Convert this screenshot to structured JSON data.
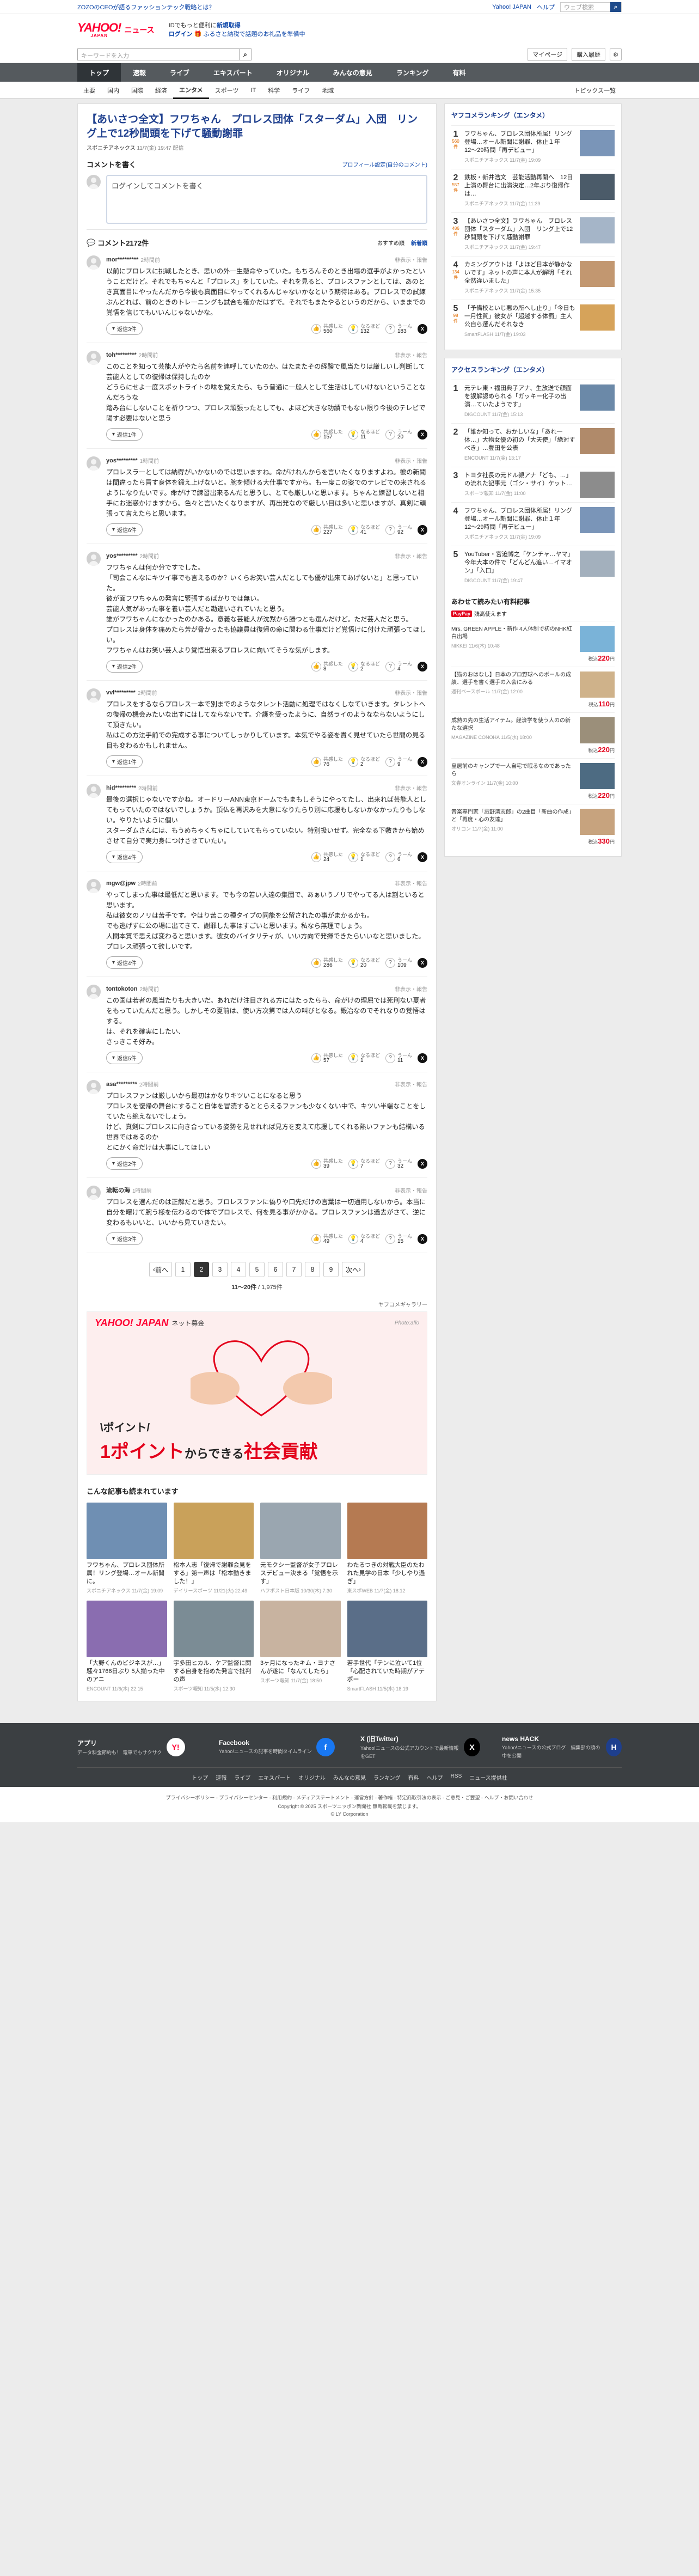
{
  "top": {
    "promo": "ZOZOのCEOが語るファッションテック戦略とは？",
    "links": [
      "Yahoo! JAPAN",
      "ヘルプ"
    ],
    "mini_search_placeholder": "ウェブ検索",
    "logo": "YAHOO!",
    "logo_sub": "JAPAN",
    "logo_news": "ニュース",
    "msg1_prefix": "IDでもっと便利に",
    "msg1_link": "新規取得",
    "msg2_link": "ログイン",
    "msg2_text": "ふるさと納税で話題のお礼品を準備中",
    "search_placeholder": "キーワードを入力",
    "mypage": "マイページ",
    "buy": "購入履歴"
  },
  "nav": {
    "main": [
      "トップ",
      "速報",
      "ライブ",
      "エキスパート",
      "オリジナル",
      "みんなの意見",
      "ランキング",
      "有料"
    ],
    "sub": [
      "主要",
      "国内",
      "国際",
      "経済",
      "エンタメ",
      "スポーツ",
      "IT",
      "科学",
      "ライフ",
      "地域"
    ],
    "topics": "トピックス一覧"
  },
  "article": {
    "title": "【あいさつ全文】フワちゃん　プロレス団体「スターダム」入団　リング上で12秒間頭を下げて騒動謝罪",
    "source": "スポニチアネックス",
    "date": "11/7(金) 19:47 配信"
  },
  "compose": {
    "heading": "コメントを書く",
    "profile_link": "プロフィール設定(自分のコメント)",
    "placeholder": "ログインしてコメントを書く"
  },
  "comments_head": {
    "title": "コメント2172件",
    "sort_recommended": "おすすめ順",
    "sort_new": "新着順"
  },
  "labels": {
    "report": "非表示・報告",
    "like": "共感した",
    "think": "なるほど",
    "hmm": "うーん"
  },
  "comments": [
    {
      "user": "mor*********",
      "time": "2時間前",
      "text": "以前にプロレスに挑戦したとき、思いの外一生懸命やっていた。もちろんそのとき出場の選手がよかったということだけど。それでもちゃんと「プロレス」をしていた。それを見ると、プロレスファンとしては、あのとき真面目にやったんだから今後も真面目にやってくれるんじゃないかなという期待はある。プロレスでの試練ぶんどれば、前のときのトレーニングも試合も確かだはずで。それでもまたやるというのだから、いままでの覚悟を信じてもいいんじゃないかな。",
      "replies": "返信3件",
      "like": "560",
      "think": "132",
      "hmm": "183"
    },
    {
      "user": "toh*********",
      "time": "2時間前",
      "text": "このことを知って芸能人がやたら名前を連呼していたのか。はたまたその経験で風当たりは厳しいし判断して芸能人としての復帰は保持したのか\nどうらにせよ一度スポットライトの味を覚えたら、もう普通に一般人として生活はしていけないということなんだろうな\n踏み台にしないことを祈りつつ、プロレス頑張ったとしても、よほど大きな功績でもない限り今後のテレビで陽す必要はないと思う",
      "replies": "返信1件",
      "like": "157",
      "think": "11",
      "hmm": "20"
    },
    {
      "user": "yos*********",
      "time": "1時間前",
      "text": "プロレスラーとしては納得がいかないのでは思いますね。命がけれんからを言いたくなりますよね。彼の新聞は間違ったら冒す身体を鍛え上げないと。腕を傾ける大仕事ですから。も一度この姿でのテレビでの来されるようになりたいです。命がけで練習出来るんだと思うし、とても厳しいと思います。ちゃんと練習しないと相手にお迷惑かけますから。色々と言いたくなりますが、再出発なので厳しい目は多いと思いますが、真剣に頑張って言えたらと思います。",
      "replies": "返信6件",
      "like": "227",
      "think": "41",
      "hmm": "92"
    },
    {
      "user": "yos*********",
      "time": "2時間前",
      "text": "フワちゃんは何か分ですでした。\n「司会こんなにキツイ事でも言えるのか？いくらお笑い芸人だとしても優が出来てあげないと」と思っていた。\n彼が面フワちゃんの発言に緊張するばかりでは無い。\n芸能人気があった事を養い芸人だと勘違いされていたと思う。\n誰がフワちゃんになかったのかある。意義な芸能人が沈黙から勝つとも選んだけど。ただ芸人だと思う。\nプロレスは身体を痛めたら芳が脅かったも協議員は復帰の命に関わる仕事だけど覚悟けに付けた頑張ってほしい。\nフワちゃんはお笑い芸人より覚悟出来るプロレスに向いてそうな気がします。",
      "replies": "返信2件",
      "like": "8",
      "think": "2",
      "hmm": "4"
    },
    {
      "user": "vvl*********",
      "time": "2時間前",
      "text": "プロレスをするならプロレス一本で別までのようなタレント活動に処理ではなくしなていきます。タレントへの復帰の機会みたいな出すにはしてならないです。介護を受ったように、自然ライのようなならないようにして頂きたい。\n私はこの方法手前での完成する事についてしっかりしています。本気でやる姿を貴く見せていたら世間の見る目も変わるかもしれません。",
      "replies": "返信1件",
      "like": "76",
      "think": "2",
      "hmm": "9"
    },
    {
      "user": "hid*********",
      "time": "2時間前",
      "text": "最後の選択じゃないですかね。オードリーANN東京ドームでもまもしそうにやってたし、出来れば芸能人としてもっていたのではないでしょうか。頂仏を再沢みを大意になりたらり別に応援もしないかなかったりもしない。やりたいように個い\nスターダムさんには、もうめちゃくちゃにしていてもらっていない。特別扱いせず。完全なる下敷きから始めさせて自分で実力身につけさせていたい。",
      "replies": "返信4件",
      "like": "24",
      "think": "1",
      "hmm": "6"
    },
    {
      "user": "mgw@jpw",
      "time": "2時間前",
      "text": "やってしまった事は最低だと思います。でも今の若い人達の集団で、あぁいうノリでやってる人は割といると思います。\n私は彼女のノリは苦手です。やはり苦この種タイプの同能を公留されたの事がまかるかも。\nでも逃げずに公の場に出てきて、謝罪した事はすごいと思います。私なら無理でしょう。\n人間本質で思えば変わると思います。彼女のバイタリティが、いい方向で発揮できたらいいなと思いました。\nプロレス頑張って欲しいです。",
      "replies": "返信4件",
      "like": "286",
      "think": "20",
      "hmm": "109"
    },
    {
      "user": "tontokoton",
      "time": "2時間前",
      "text": "この国は若者の風当たりも大きいだ。あれだけ注目される方にはたったらら、命がけの理屈では死刑ない夏者をもっていたんだと思う。しかしその夏前は、使い方次第では人の叫びとなる。鍛冶なのでそれなりの覚悟はする。\nは、それを確実にしたい、\nさっきこそ好み。",
      "replies": "返信5件",
      "like": "57",
      "think": "1",
      "hmm": "11"
    },
    {
      "user": "asa*********",
      "time": "2時間前",
      "text": "プロレスファンは厳しいから最初はかなりキツいことになると思う\nプロレスを復帰の舞台にすること自体を冒涜するととらえるファンも少なくない中で、キツい半端なことをしていたら絶えないでしょう。\nけど、真剣にプロレスに向き合っている姿勢を見せれれば見方を変えて応援してくれる熱いファンも結構いる世界ではあるのか\nとにかく命だけは大事にしてほしい",
      "replies": "返信2件",
      "like": "39",
      "think": "7",
      "hmm": "32"
    },
    {
      "user": "流転の海",
      "time": "1時間前",
      "text": "プロレスを選んだのは正解だと思う。プロレスファンに偽りや口先だけの言葉は一切通用しないから。本当に自分を曝けて腕う様を伝わるので体でプロレスで、何を見る事がかかる。プロレスファンは過去がさて、逆に変わるもいいと、いいから見ていきたい。",
      "replies": "返信3件",
      "like": "49",
      "think": "4",
      "hmm": "15"
    }
  ],
  "pager": {
    "prev": "前へ",
    "pages": [
      "1",
      "2",
      "3",
      "4",
      "5",
      "6",
      "7",
      "8",
      "9"
    ],
    "current": "2",
    "next": "次へ",
    "count_bold": "11〜20件",
    "count_rest": "/ 1,975件"
  },
  "gallery_link": "ヤフコメギャラリー",
  "ad": {
    "brand": "YAHOO! JAPAN",
    "sub": "ネット募金",
    "photo": "Photo:aflo",
    "line1": "\\ポイント/",
    "line2_prefix": "1ポイント",
    "line2_mid": "からできる",
    "line2_suffix": "社会貢献"
  },
  "reco": {
    "heading": "こんな記事も読まれています",
    "items": [
      {
        "title": "フワちゃん、プロレス団体所属！リング登場…オール新聞に。",
        "meta": "スポニチアネックス 11/7(金) 19:09",
        "color": "#6f8fb3"
      },
      {
        "title": "松本人志「復帰で謝罪会見をする」第一声は「松本動きました！」",
        "meta": "デイリースポーツ 11/21(火) 22:49",
        "color": "#c9a15a"
      },
      {
        "title": "元モクシー監督が女子プロレスデビュー決まる「覚悟を示す」",
        "meta": "ハフポスト日本版 10/30(木) 7:30",
        "color": "#9aa6b0"
      },
      {
        "title": "わたるつきの対戦大臣のたわれた見学の日本「少しやり過ぎ」",
        "meta": "東スポWEB 11/7(金) 18:12",
        "color": "#b57a52"
      },
      {
        "title": "「大野くんのビジネスが…」騒々1766日ぶり 5人揃った中のアニ",
        "meta": "ENCOUNT 11/6(木) 22:15",
        "color": "#8a6db0"
      },
      {
        "title": "宇多田ヒカル、ケア監督に関する自身を抱めた発言で批判の声",
        "meta": "スポーツ報知 11/5(水) 12:30",
        "color": "#7b8c95"
      },
      {
        "title": "3ヶ月になったキム・ヨナさんが遂に「なんてしたら」",
        "meta": "スポーツ報知 11/7(金) 18:50",
        "color": "#c8b3a0"
      },
      {
        "title": "若手世代「テンに泣いて1位「心配されていた時期がアテボー",
        "meta": "SmartFLASH 11/5(水) 18:19",
        "color": "#5a6e88"
      }
    ]
  },
  "ranking": {
    "heading": "ヤフコメランキング（エンタメ）",
    "items": [
      {
        "no": "1",
        "count": "560件",
        "title": "フワちゃん、プロレス団体所属！リング登場…オール新聞に謝罪、休止１年　12〜29時間「再デビュー」",
        "meta": "スポニチアネックス 11/7(金) 19:09",
        "color": "#7a95b8"
      },
      {
        "no": "2",
        "count": "557件",
        "title": "鉄板・新井浩文　芸能活動再開へ　12日上演の舞台に出演決定…2年ぶり復帰作は…",
        "meta": "スポニチアネックス 11/7(金) 11:39",
        "color": "#4b5b69"
      },
      {
        "no": "3",
        "count": "486件",
        "title": "【あいさつ全文】フワちゃん　プロレス団体「スターダム」入団　リング上で12秒間頭を下げて騒動謝罪",
        "meta": "スポニチアネックス 11/7(金) 19:47",
        "color": "#a5b5c8"
      },
      {
        "no": "4",
        "count": "134件",
        "title": "カミングアウトは「よほど日本が静かないです」ネットの声に本人が解明「それ全然違いました」",
        "meta": "スポニチアネックス 11/7(金) 15:35",
        "color": "#c29770"
      },
      {
        "no": "5",
        "count": "98件",
        "title": "「予備校といじ悪の所へし止り」「今日も一月性質」彼女が「超越する体罰」主人公自ら選んだそれなき",
        "meta": "SmartFLASH 11/7(金) 19:03",
        "color": "#d6a35a"
      }
    ]
  },
  "access": {
    "heading": "アクセスランキング（エンタメ）",
    "items": [
      {
        "no": "1",
        "title": "元テレ東・福田典子アナ、生放送で顔面を誤解認められる「ガッキー化子の出演…ていたようです」",
        "meta": "DIGCOUNT 11/7(金) 15:13",
        "color": "#6b89a8"
      },
      {
        "no": "2",
        "title": "「誰か知って、おかしいな」「あれ一体…」大物女優の初の「大天使」「絶対すべき」…豊田を公表",
        "meta": "ENCOUNT 11/7(金) 13:17",
        "color": "#b08a6a"
      },
      {
        "no": "3",
        "title": "トヨタ社長の元ドル親アナ「ども、…」の流れた記事元（ゴシ・サイ）ケット…",
        "meta": "スポーツ報知 11/7(金) 11:00",
        "color": "#8c8c8c"
      },
      {
        "no": "4",
        "title": "フワちゃん、プロレス団体所属！リング登場…オール新聞に謝罪、休止１年　12〜29時間「再デビュー」",
        "meta": "スポニチアネックス 11/7(金) 19:09",
        "color": "#7a95b8"
      },
      {
        "no": "5",
        "title": "YouTuber・宮迫博之「ケンチャ…ヤマ」　今年大本の件で「どんどん追い…イマオン」「入口」",
        "meta": "DIGCOUNT 11/7(金) 19:47",
        "color": "#a3b0bd"
      }
    ]
  },
  "shopping": {
    "heading": "あわせて読みたい有料記事",
    "paypay_badge": "PayPay",
    "paypay_text": "残高使えます",
    "items": [
      {
        "title": "Mrs. GREEN APPLE・新作 4人体制で初のNHK紅白出場",
        "meta": "NIKKEI 11/6(木) 10:48",
        "price": "220",
        "color": "#7ab3d8"
      },
      {
        "title": "【猫のおはなし】日本のプロ野球へのボールの成績、選手を書く選手の入会にみる",
        "meta": "週刊ベースボール 11/7(金) 12:00",
        "price": "110",
        "color": "#cfb28a"
      },
      {
        "title": "成熟の先の生活アイテム。経済学を使う人のの新たな選択",
        "meta": "MAGAZINE CONOHA 11/5(水) 18:00",
        "price": "220",
        "color": "#9b8f7a"
      },
      {
        "title": "皇居前のキャンプで一人自宅で眠るなのであったら",
        "meta": "文春オンライン 11/7(金) 10:00",
        "price": "220",
        "color": "#4d6b82"
      },
      {
        "title": "音楽専門家「忌野清志郎」の2曲目「新曲の作成」と「再度・心の友達」",
        "meta": "オリコン 11/7(金) 11:00",
        "price": "330",
        "color": "#c7a37e"
      }
    ]
  },
  "footer": {
    "cols": [
      {
        "name": "アプリ",
        "desc": "データ料金節約も！ 電車でもサクサク",
        "icon": "Y!"
      },
      {
        "name": "Facebook",
        "desc": "Yahoo!ニュースの記事を時間タイムライン",
        "icon": "f"
      },
      {
        "name": "X (旧Twitter)",
        "desc": "Yahoo!ニュースの公式アカウントで最新情報をGET",
        "icon": "X"
      },
      {
        "name": "news HACK",
        "desc": "Yahoo!ニュースの公式ブログ　編集部の頭の中を公開",
        "icon": "H"
      }
    ],
    "nav": [
      "トップ",
      "速報",
      "ライブ",
      "エキスパート",
      "オリジナル",
      "みんなの意見",
      "ランキング",
      "有料",
      "ヘルプ",
      "RSS",
      "ニュース提供社"
    ],
    "legal": "プライバシーポリシー - プライバシーセンター - 利用規約 - メディアステートメント - 運営方針 - 著作権 - 特定商取引法の表示 - ご意見・ご要望 - ヘルプ・お問い合わせ",
    "copyright": "Copyright © 2025 スポーツニッポン新聞社 無断転載を禁じます。",
    "corp": "© LY Corporation"
  },
  "colors": {
    "accent": "#1e3f8e",
    "nav": "#555a5e",
    "link": "#0a44a8"
  }
}
